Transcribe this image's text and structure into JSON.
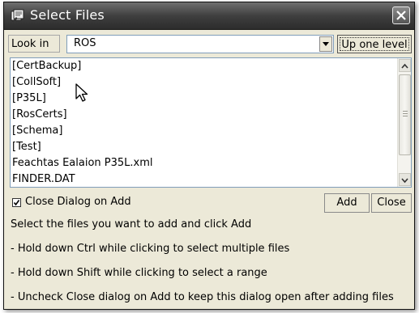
{
  "window": {
    "title": "Select Files",
    "icon": "select-files-app-icon",
    "close_icon": "close-icon"
  },
  "look_in": {
    "label": "Look in",
    "value": "ROS",
    "dropdown_icon": "chevron-down-icon",
    "up_one_level_label": "Up one level"
  },
  "file_list": {
    "items": [
      "[CertBackup]",
      "[CollSoft]",
      "[P35L]",
      "[RosCerts]",
      "[Schema]",
      "[Test]",
      "Feachtas Ealaion P35L.xml",
      "FINDER.DAT"
    ]
  },
  "options": {
    "close_on_add_label": "Close Dialog on Add",
    "close_on_add_checked": true,
    "add_label": "Add",
    "close_label": "Close"
  },
  "help": {
    "lines": [
      "Select the files you want to add and click Add",
      " - Hold down Ctrl while clicking to select multiple files",
      " - Hold down Shift while clicking to select a range",
      " - Uncheck Close dialog on Add to keep this dialog open after adding files"
    ]
  }
}
